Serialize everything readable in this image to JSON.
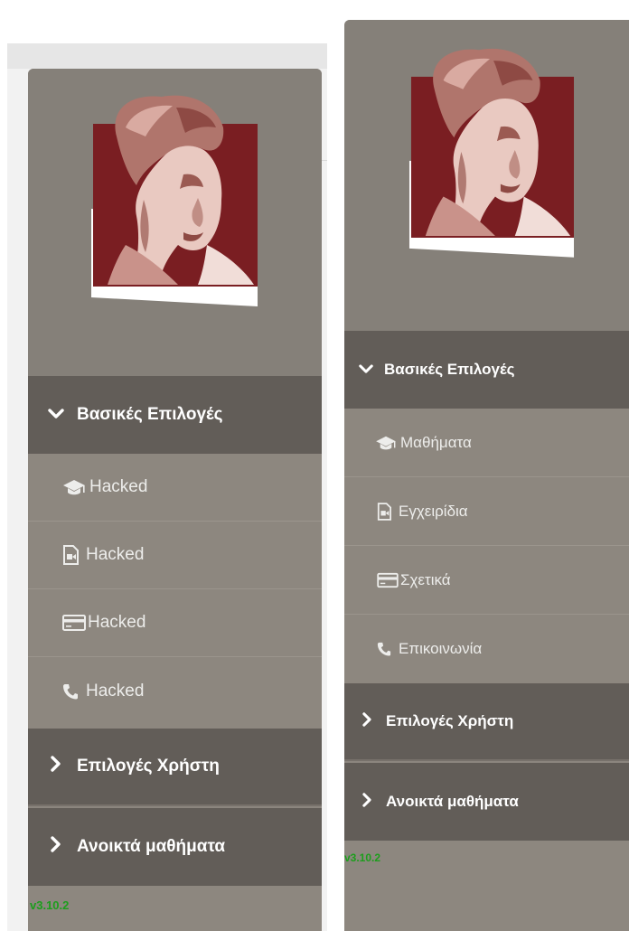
{
  "left": {
    "section_basic": "Βασικές Επιλογές",
    "items": [
      {
        "icon": "graduation-cap-icon",
        "label": "Hacked"
      },
      {
        "icon": "document-video-icon",
        "label": "Hacked"
      },
      {
        "icon": "credit-card-icon",
        "label": "Hacked"
      },
      {
        "icon": "phone-icon",
        "label": "Hacked"
      }
    ],
    "section_user": "Επιλογές Χρήστη",
    "section_open": "Ανοικτά μαθήματα",
    "version": "v3.10.2"
  },
  "right": {
    "section_basic": "Βασικές Επιλογές",
    "items": [
      {
        "icon": "graduation-cap-icon",
        "label": "Μαθήματα"
      },
      {
        "icon": "document-video-icon",
        "label": "Εγχειρίδια"
      },
      {
        "icon": "credit-card-icon",
        "label": "Σχετικά"
      },
      {
        "icon": "phone-icon",
        "label": "Επικοινωνία"
      }
    ],
    "section_user": "Επιλογές Χρήστη",
    "section_open": "Ανοικτά μαθήματα",
    "version": "v3.10.2"
  },
  "colors": {
    "sidebar_bg": "#8d877f",
    "section_bg": "#625d58",
    "logo_red": "#7a1e22",
    "version_green": "#1c9e1c"
  }
}
